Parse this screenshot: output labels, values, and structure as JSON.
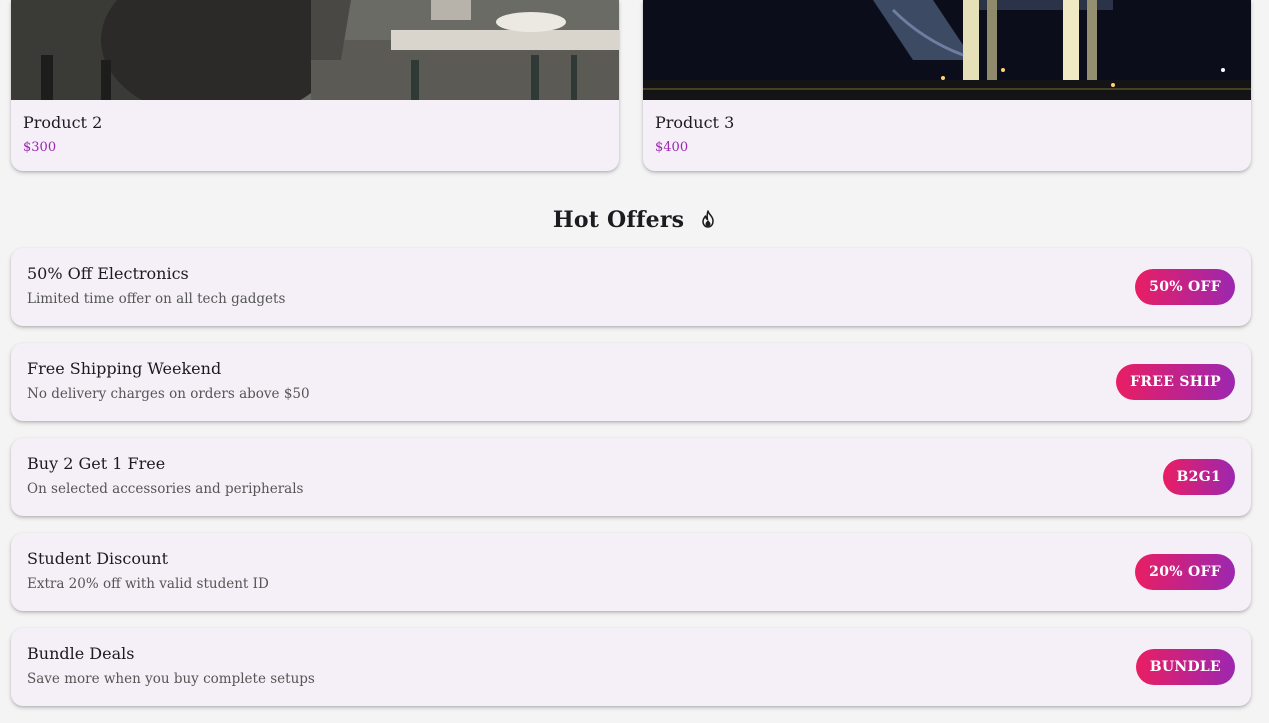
{
  "products": [
    {
      "name": "Product 2",
      "price": "$300",
      "image_icon": "cafe-photo"
    },
    {
      "name": "Product 3",
      "price": "$400",
      "image_icon": "bridge-night-photo"
    }
  ],
  "offers_section": {
    "title": "Hot Offers",
    "title_icon": "fire-icon",
    "items": [
      {
        "title": "50% Off Electronics",
        "description": "Limited time offer on all tech gadgets",
        "badge": "50% OFF"
      },
      {
        "title": "Free Shipping Weekend",
        "description": "No delivery charges on orders above $50",
        "badge": "FREE SHIP"
      },
      {
        "title": "Buy 2 Get 1 Free",
        "description": "On selected accessories and peripherals",
        "badge": "B2G1"
      },
      {
        "title": "Student Discount",
        "description": "Extra 20% off with valid student ID",
        "badge": "20% OFF"
      },
      {
        "title": "Bundle Deals",
        "description": "Save more when you buy complete setups",
        "badge": "BUNDLE"
      }
    ]
  },
  "colors": {
    "accent": "#9c27b0",
    "badge_start": "#e91e63",
    "badge_end": "#9c27b0",
    "card_bg": "#f5f0f8",
    "page_bg": "#f4f4f4"
  }
}
